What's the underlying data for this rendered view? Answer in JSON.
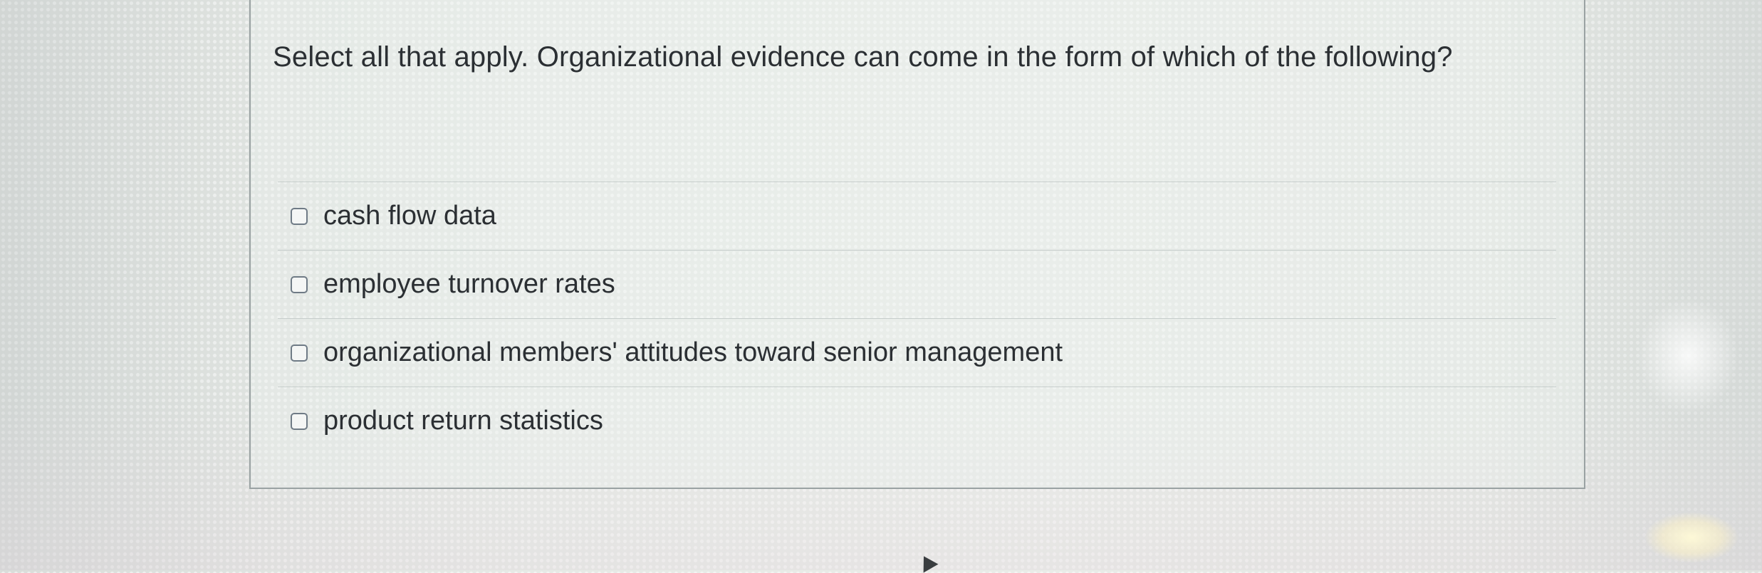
{
  "question": {
    "text": "Select all that apply. Organizational evidence can come in the form of which of the following?"
  },
  "options": [
    {
      "label": "cash flow data",
      "checked": false
    },
    {
      "label": "employee turnover rates",
      "checked": false
    },
    {
      "label": "organizational members' attitudes toward senior management",
      "checked": false
    },
    {
      "label": "product return statistics",
      "checked": false
    }
  ],
  "icons": {
    "checkbox": "checkbox-icon",
    "cursor": "mouse-pointer-icon"
  },
  "colors": {
    "text": "#2b2f33",
    "panel_border": "#9aa2a3",
    "checkbox_border": "#6f7b86",
    "background": "#e2e6e2"
  }
}
